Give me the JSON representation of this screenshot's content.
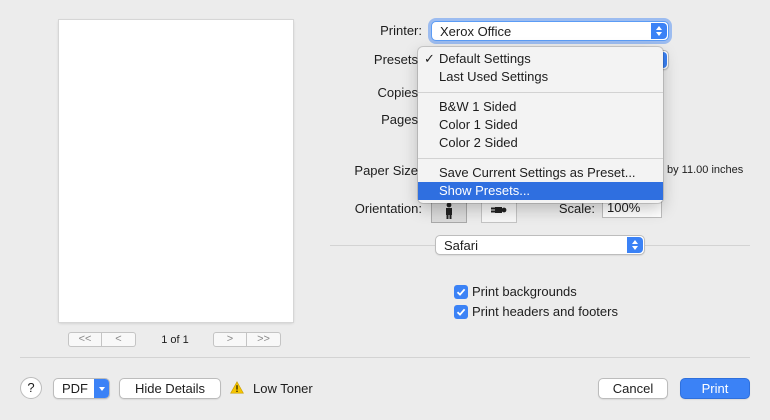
{
  "preview": {
    "first_glyph": "<<",
    "prev_glyph": "<",
    "next_glyph": ">",
    "last_glyph": ">>",
    "page_indicator": "1 of 1"
  },
  "printer": {
    "label": "Printer:",
    "value": "Xerox Office"
  },
  "presets": {
    "label": "Presets",
    "menu": {
      "checked_glyph": "✓",
      "items": [
        {
          "label": "Default Settings",
          "checked": true
        },
        {
          "label": "Last Used Settings"
        },
        {
          "label": "B&W 1 Sided"
        },
        {
          "label": "Color 1 Sided"
        },
        {
          "label": "Color 2 Sided"
        },
        {
          "label": "Save Current Settings as Preset..."
        },
        {
          "label": "Show Presets...",
          "highlighted": true
        }
      ]
    }
  },
  "copies": {
    "label": "Copies"
  },
  "pages": {
    "label": "Pages"
  },
  "paper_size": {
    "label": "Paper Size",
    "suffix": "by 11.00 inches"
  },
  "orientation": {
    "label": "Orientation:"
  },
  "scale": {
    "label": "Scale:",
    "value": "100%"
  },
  "app_section": {
    "value": "Safari",
    "options": [
      {
        "label": "Print backgrounds",
        "checked": true
      },
      {
        "label": "Print headers and footers",
        "checked": true
      }
    ]
  },
  "footer": {
    "help_label": "?",
    "pdf_label": "PDF",
    "hide_details_label": "Hide Details",
    "warning_text": "Low Toner",
    "cancel_label": "Cancel",
    "print_label": "Print"
  },
  "colors": {
    "accent": "#3b82f6",
    "menu_highlight": "#2f6fe0",
    "warning": "#f5c400"
  }
}
